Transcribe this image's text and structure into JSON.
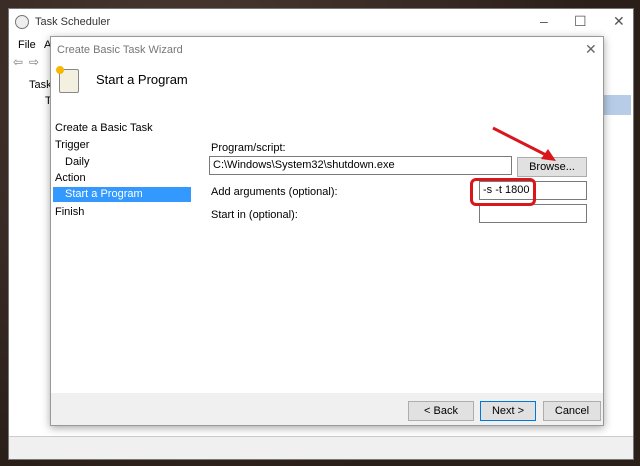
{
  "app": {
    "title": "Task Scheduler",
    "menu": [
      "File",
      "A"
    ],
    "tree": [
      "Task",
      "T"
    ]
  },
  "dialog": {
    "title": "Create Basic Task Wizard",
    "heading": "Start a Program",
    "nav": [
      {
        "label": "Create a Basic Task"
      },
      {
        "label": "Trigger"
      },
      {
        "label": "Daily"
      },
      {
        "label": "Action"
      },
      {
        "label": "Start a Program",
        "selected": true
      },
      {
        "label": "Finish"
      }
    ],
    "program_label": "Program/script:",
    "program_value": "C:\\Windows\\System32\\shutdown.exe",
    "browse_label": "Browse...",
    "args_label": "Add arguments (optional):",
    "args_value": "-s -t 1800",
    "startin_label": "Start in (optional):",
    "startin_value": "",
    "back_label": "< Back",
    "next_label": "Next >",
    "cancel_label": "Cancel"
  },
  "colors": {
    "selected": "#3399ff",
    "annotation": "#d9161c"
  }
}
